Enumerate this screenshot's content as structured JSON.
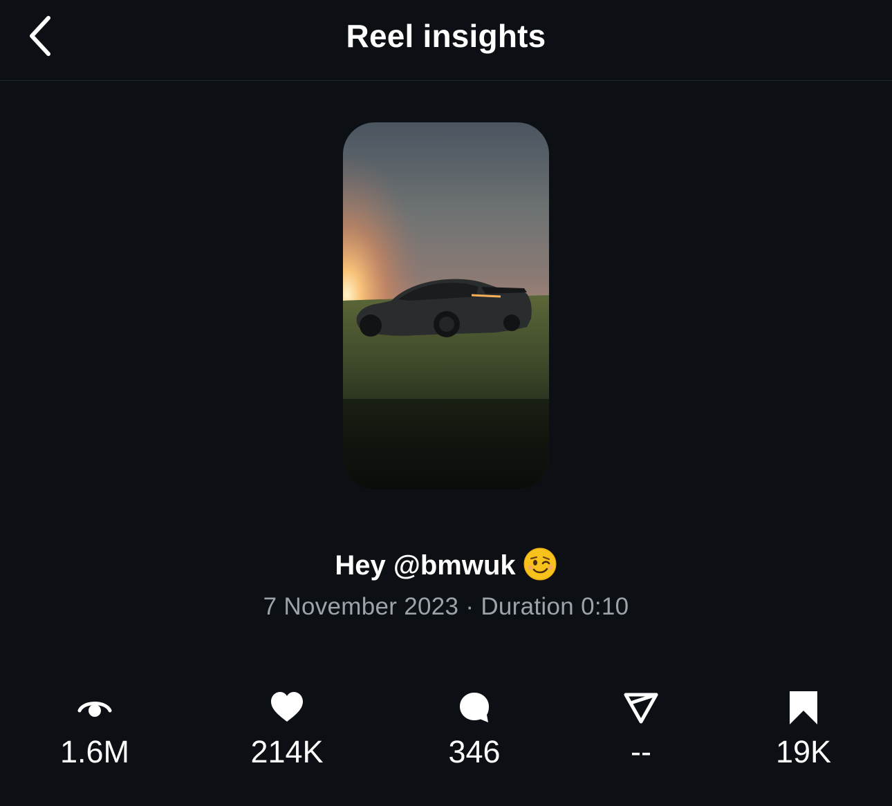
{
  "header": {
    "title": "Reel insights",
    "back_icon": "chevron-left-icon"
  },
  "reel": {
    "caption": "Hey @bmwuk",
    "caption_emoji": "winking-face-emoji",
    "date": "7 November 2023",
    "separator": "·",
    "duration_label": "Duration",
    "duration": "0:10"
  },
  "stats": [
    {
      "icon": "eye-icon",
      "value": "1.6M"
    },
    {
      "icon": "heart-icon",
      "value": "214K"
    },
    {
      "icon": "comment-icon",
      "value": "346"
    },
    {
      "icon": "share-icon",
      "value": "--"
    },
    {
      "icon": "bookmark-icon",
      "value": "19K"
    }
  ],
  "colors": {
    "background": "#0c1014",
    "text": "#ffffff",
    "secondary_text": "#9da3aa"
  }
}
